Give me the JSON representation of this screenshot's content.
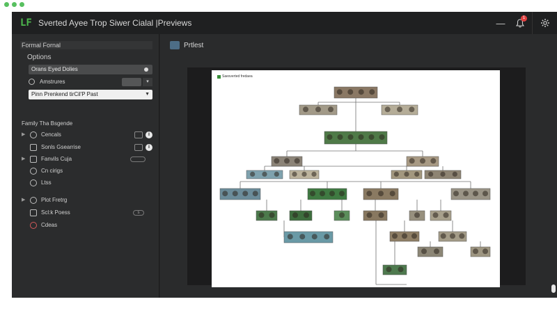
{
  "window": {
    "title": "Sverted Ayee Trop Siwer Cialal |Previews",
    "logo": "LF",
    "notification_count": "1",
    "icons": {
      "minimize": "minimize-icon",
      "bell": "bell-icon",
      "settings": "gear-icon"
    }
  },
  "sidebar": {
    "header": "Formal Fornal",
    "options_title": "Options",
    "option1": "Orans Eyed Dolies",
    "option2": "Amstrures",
    "select_value": "Pinn Prenkend tirCil'P Past",
    "section_title": "Family Tha Bsgende",
    "items": [
      {
        "label": "Cencals"
      },
      {
        "label": "Sonls Gsearrise"
      },
      {
        "label": "Fanvils Cuja"
      },
      {
        "label": "Cn cirigs"
      },
      {
        "label": "Ltss"
      },
      {
        "label": "Plot Fretrg"
      },
      {
        "label": "Scl:k Poess"
      },
      {
        "label": "Cdeas"
      }
    ]
  },
  "main": {
    "header": "Prtlest",
    "paper_label": "Saesverted fredaea",
    "accent": "#3a8f3a"
  }
}
